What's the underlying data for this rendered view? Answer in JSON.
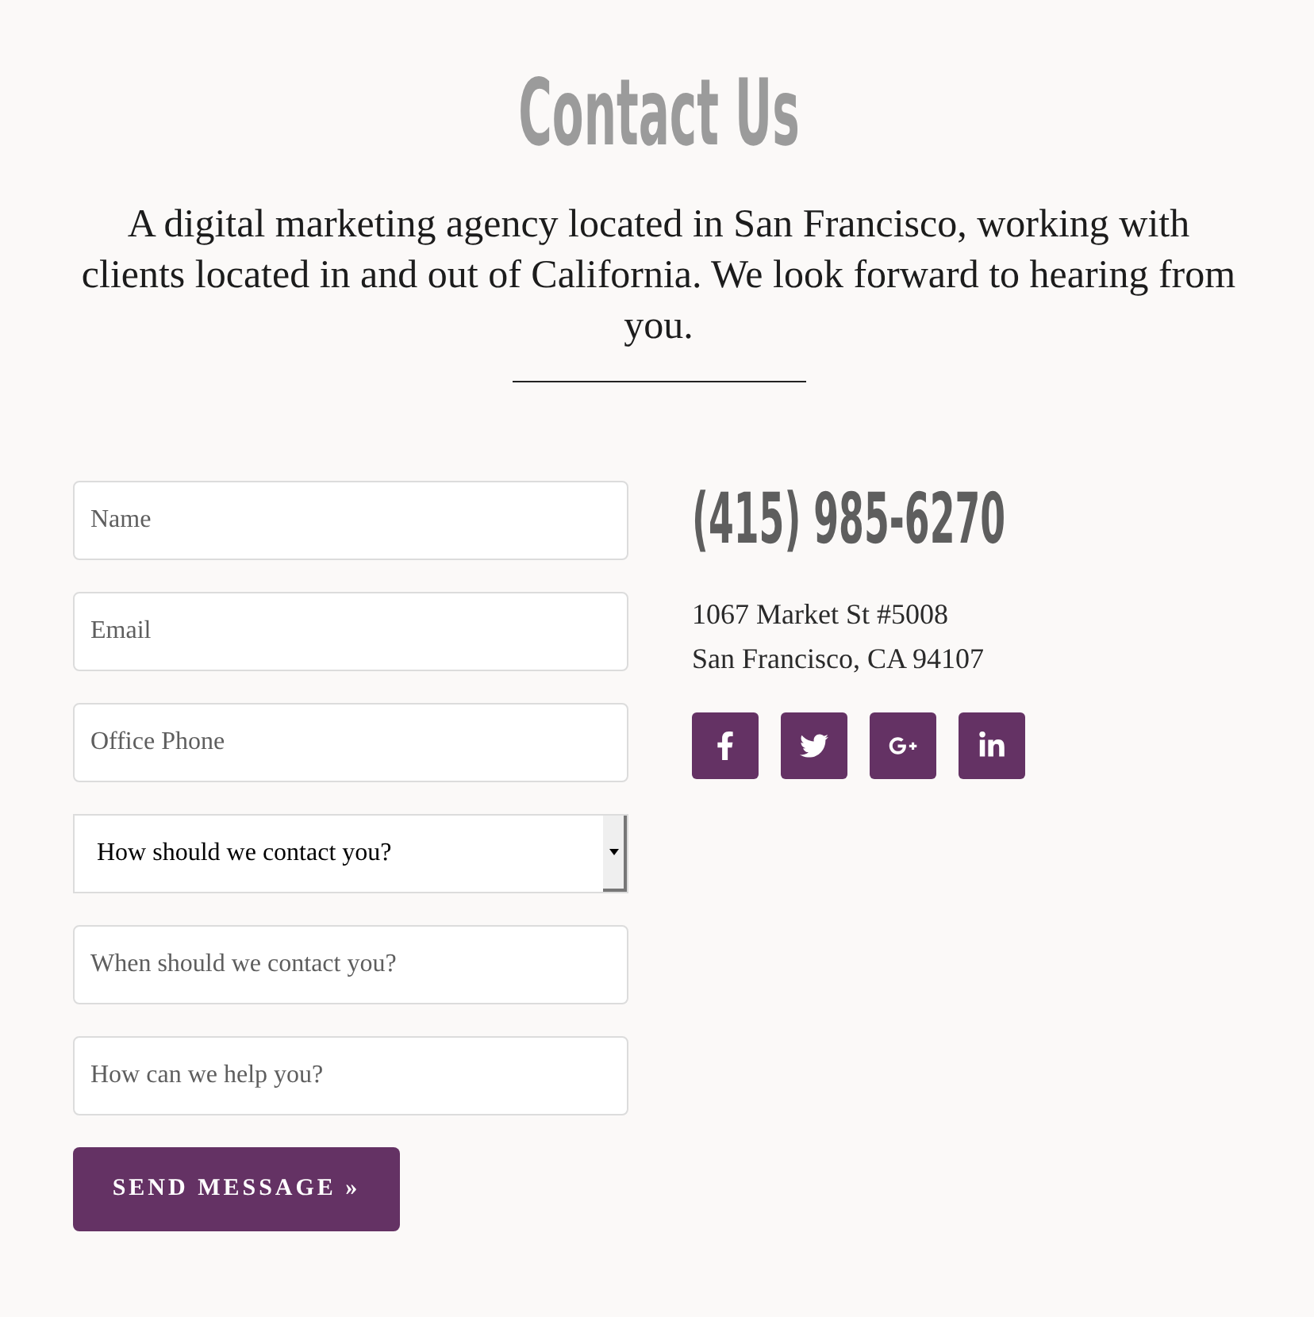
{
  "header": {
    "title": "Contact Us",
    "intro": "A digital marketing agency located in San Francisco, working with clients located in and out of California. We look forward to hearing from you."
  },
  "form": {
    "fields": [
      {
        "kind": "input",
        "placeholder": "Name"
      },
      {
        "kind": "input",
        "placeholder": "Email"
      },
      {
        "kind": "input",
        "placeholder": "Office Phone"
      },
      {
        "kind": "select",
        "value": "How should we contact you?"
      },
      {
        "kind": "input",
        "placeholder": "When should we contact you?"
      },
      {
        "kind": "input",
        "placeholder": "How can we help you?"
      }
    ],
    "submit": "SEND MESSAGE »"
  },
  "contact": {
    "phone": "(415) 985-6270",
    "address_lines": [
      "1067 Market St #5008",
      "San Francisco, CA 94107"
    ]
  }
}
